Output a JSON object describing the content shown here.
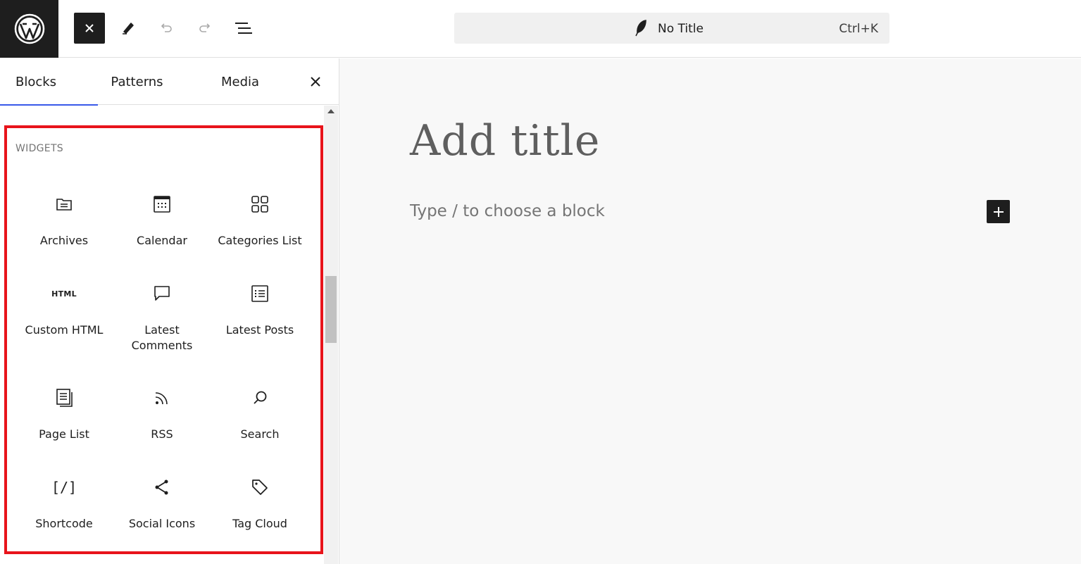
{
  "toolbar": {
    "logo": "wordpress-logo",
    "close_icon": "close-icon",
    "edit_icon": "pencil-icon",
    "undo_icon": "undo-icon",
    "redo_icon": "redo-icon",
    "list_view_icon": "list-view-icon"
  },
  "command_bar": {
    "title": "No Title",
    "shortcut": "Ctrl+K"
  },
  "sidebar": {
    "tabs": [
      {
        "label": "Blocks",
        "active": true
      },
      {
        "label": "Patterns",
        "active": false
      },
      {
        "label": "Media",
        "active": false
      }
    ],
    "section_title": "WIDGETS",
    "blocks": [
      {
        "label": "Archives",
        "icon": "archive-icon"
      },
      {
        "label": "Calendar",
        "icon": "calendar-icon"
      },
      {
        "label": "Categories List",
        "icon": "categories-icon"
      },
      {
        "label": "Custom HTML",
        "icon": "html-icon",
        "glyph": "HTML"
      },
      {
        "label": "Latest Comments",
        "icon": "comment-icon"
      },
      {
        "label": "Latest Posts",
        "icon": "post-list-icon"
      },
      {
        "label": "Page List",
        "icon": "page-list-icon"
      },
      {
        "label": "RSS",
        "icon": "rss-icon"
      },
      {
        "label": "Search",
        "icon": "search-icon"
      },
      {
        "label": "Shortcode",
        "icon": "shortcode-icon",
        "glyph": "[/]"
      },
      {
        "label": "Social Icons",
        "icon": "share-icon"
      },
      {
        "label": "Tag Cloud",
        "icon": "tag-icon"
      }
    ]
  },
  "editor": {
    "title_placeholder": "Add title",
    "block_placeholder": "Type / to choose a block"
  },
  "colors": {
    "highlight": "#e8141b",
    "dark": "#1e1e1e",
    "tab_underline": "#3858e9"
  }
}
